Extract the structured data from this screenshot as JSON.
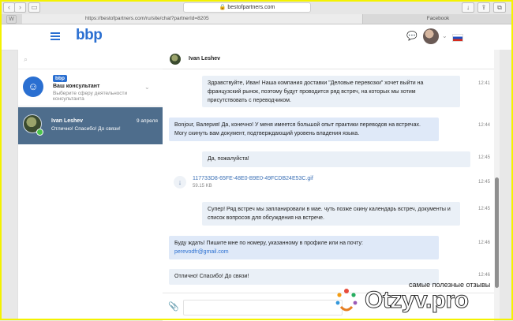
{
  "browser": {
    "url": "https://bestofpartners.com/ru/site/chat?partnerId=8205",
    "address_domain": "bestofpartners.com",
    "tab_facebook": "Facebook"
  },
  "header": {
    "logo": "bbp"
  },
  "sidebar": {
    "consultant": {
      "badge": "bbp",
      "name": "Ваш консультант",
      "subtitle": "Выберите сферу деятельности консультанта"
    },
    "contact": {
      "name": "Ivan Leshev",
      "date": "9 апреля",
      "last_message": "Отлично! Спасибо! До связи!"
    }
  },
  "chat": {
    "contact_name": "Ivan Leshev",
    "messages": [
      {
        "text": "Здравствуйте, Иван! Наша компания доставки \"Деловые перевозки\" хочет выйти на французский рынок, поэтому будут проводится ряд встреч, на которых мы хотим присутствовать с переводчиком.",
        "time": "12:41"
      },
      {
        "text": "Bonjour, Валерия! Да, конечно! У меня имеется большой опыт практики переводов на встречах. Могу скинуть вам документ, подтверждающий уровень владения языка.",
        "time": "12:44"
      },
      {
        "text": "Да, пожалуйста!",
        "time": "12:45"
      },
      {
        "file_name": "117733D8-65FE-48E0-B9E0-49FCDB24E53C.gif",
        "file_size": "59.15 KB",
        "time": "12:45"
      },
      {
        "text": "Супер! Ряд встреч мы запланировали в мае. чуть позже скину календарь встреч, документы и список вопросов для обсуждения на встрече.",
        "time": "12:45"
      },
      {
        "text": "Буду ждать! Пишите мне по номеру, указанному в профиле или на почту:",
        "link": "perevodfr@gmail.com",
        "time": "12:46"
      },
      {
        "text": "Отлично! Спасибо! До связи!",
        "time": "12:46"
      }
    ]
  },
  "watermark": {
    "tagline": "самые полезные отзывы",
    "brand": "Otzyv.pro"
  },
  "colors": {
    "accent": "#2a6fd1",
    "selected_contact": "#4e6d8c"
  }
}
